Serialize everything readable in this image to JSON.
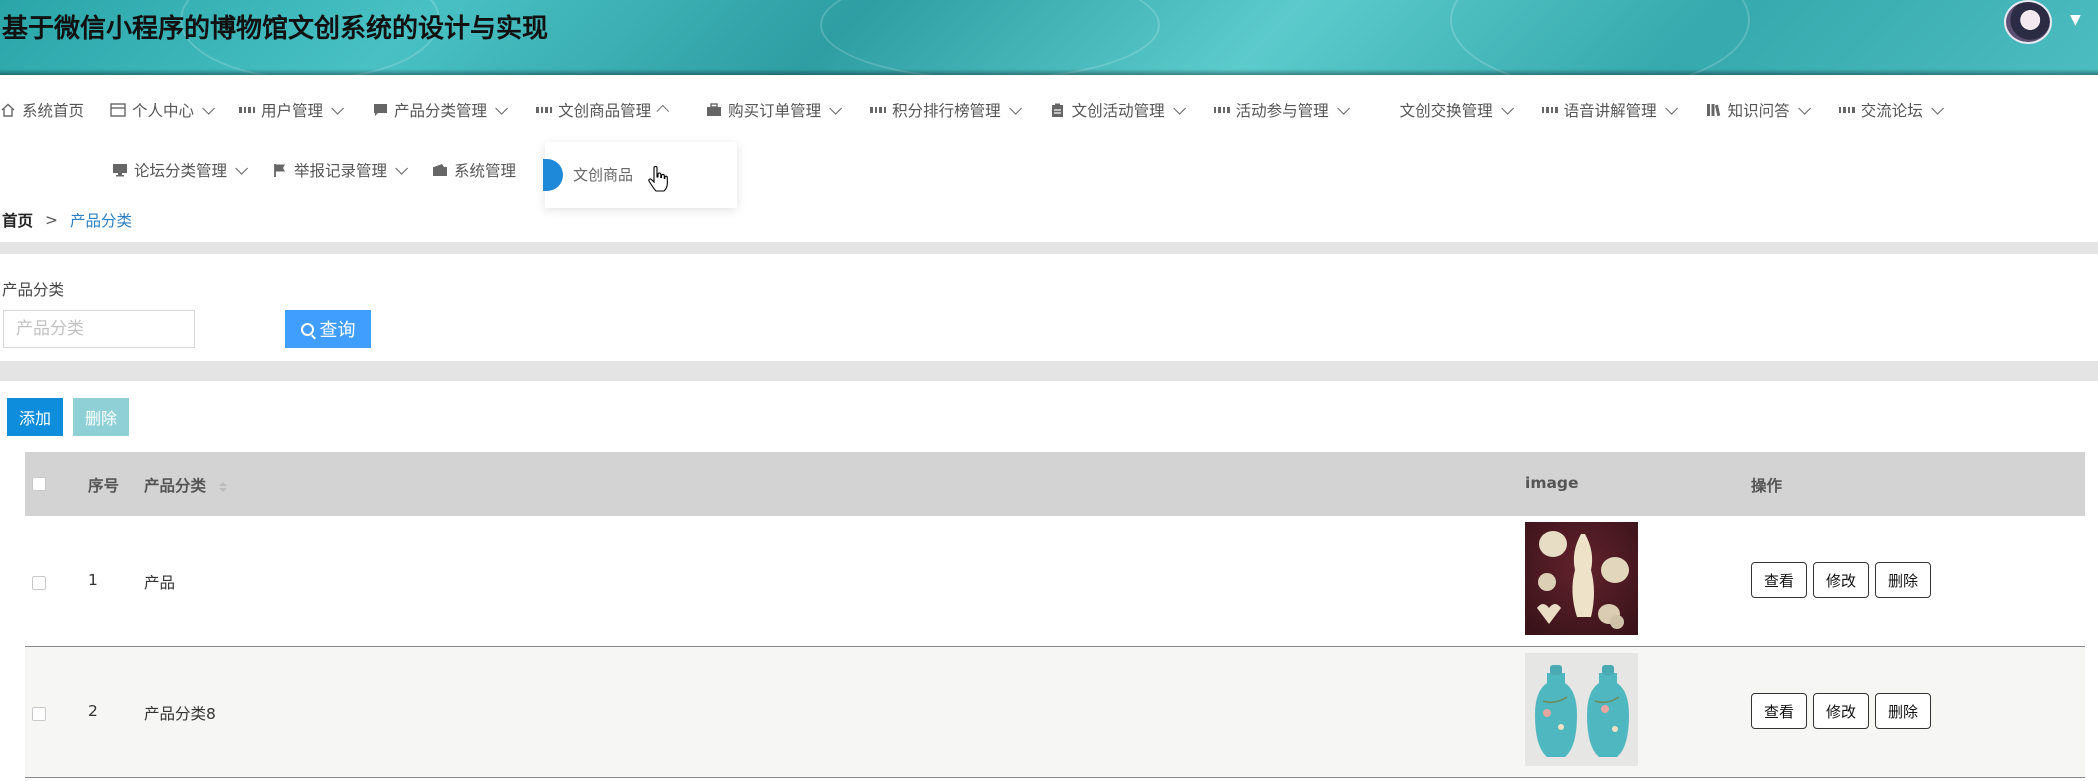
{
  "header": {
    "title": "基于微信小程序的博物馆文创系统的设计与实现"
  },
  "nav": {
    "row1": [
      {
        "label": "系统首页",
        "icon": "home-icon"
      },
      {
        "label": "个人中心",
        "icon": "profile-icon"
      },
      {
        "label": "用户管理",
        "icon": "grid-icon"
      },
      {
        "label": "产品分类管理",
        "icon": "chat-icon"
      },
      {
        "label": "文创商品管理",
        "icon": "grid-icon"
      },
      {
        "label": "购买订单管理",
        "icon": "briefcase-icon"
      },
      {
        "label": "积分排行榜管理",
        "icon": "grid-icon"
      },
      {
        "label": "文创活动管理",
        "icon": "clipboard-icon"
      },
      {
        "label": "活动参与管理",
        "icon": "grid-icon"
      },
      {
        "label": "文创交换管理",
        "icon": "grid9-icon"
      },
      {
        "label": "语音讲解管理",
        "icon": "grid-icon"
      },
      {
        "label": "知识问答",
        "icon": "library-icon"
      },
      {
        "label": "交流论坛",
        "icon": "grid-icon"
      }
    ],
    "row2": [
      {
        "label": "论坛分类管理",
        "icon": "monitor-icon"
      },
      {
        "label": "举报记录管理",
        "icon": "flag-icon"
      },
      {
        "label": "系统管理",
        "icon": "wallet-icon"
      }
    ],
    "dropdown_item": "文创商品"
  },
  "breadcrumb": {
    "home": "首页",
    "separator": ">",
    "current": "产品分类"
  },
  "search": {
    "label": "产品分类",
    "placeholder": "产品分类",
    "button": "查询"
  },
  "actions": {
    "add": "添加",
    "delete": "删除"
  },
  "table": {
    "headers": {
      "index": "序号",
      "category": "产品分类",
      "image": "image",
      "ops": "操作"
    },
    "rows": [
      {
        "index": "1",
        "category": "产品"
      },
      {
        "index": "2",
        "category": "产品分类8"
      }
    ],
    "row_buttons": {
      "view": "查看",
      "edit": "修改",
      "delete": "删除"
    }
  },
  "colors": {
    "primary": "#409eff",
    "add_button": "#0d8ddb",
    "delete_button": "#8ed0d6",
    "breadcrumb_current": "#2b7fc4",
    "header_teal": "#2aa5a8"
  }
}
